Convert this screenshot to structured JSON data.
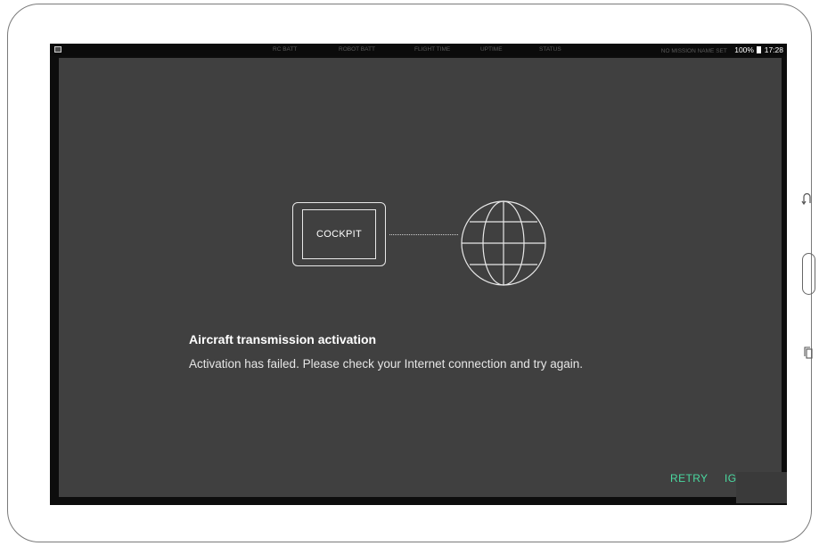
{
  "status_bar": {
    "labels": [
      "RC BATT",
      "ROBOT BATT",
      "FLIGHT TIME",
      "UPTIME",
      "STATUS"
    ],
    "mission": "No mission name set",
    "battery": "100%",
    "time": "17:28"
  },
  "illustration": {
    "device_label": "COCKPIT"
  },
  "dialog": {
    "title": "Aircraft transmission activation",
    "message": "Activation has failed. Please check your Internet connection and try again.",
    "retry_label": "RETRY",
    "ignore_label": "IGNORE"
  },
  "colors": {
    "panel": "#404040",
    "accent": "#4ad9a0",
    "frame": "#0d0d0d"
  },
  "icons": [
    "image-icon",
    "battery-icon",
    "globe-icon",
    "back-icon",
    "home-button",
    "recent-apps-icon"
  ]
}
